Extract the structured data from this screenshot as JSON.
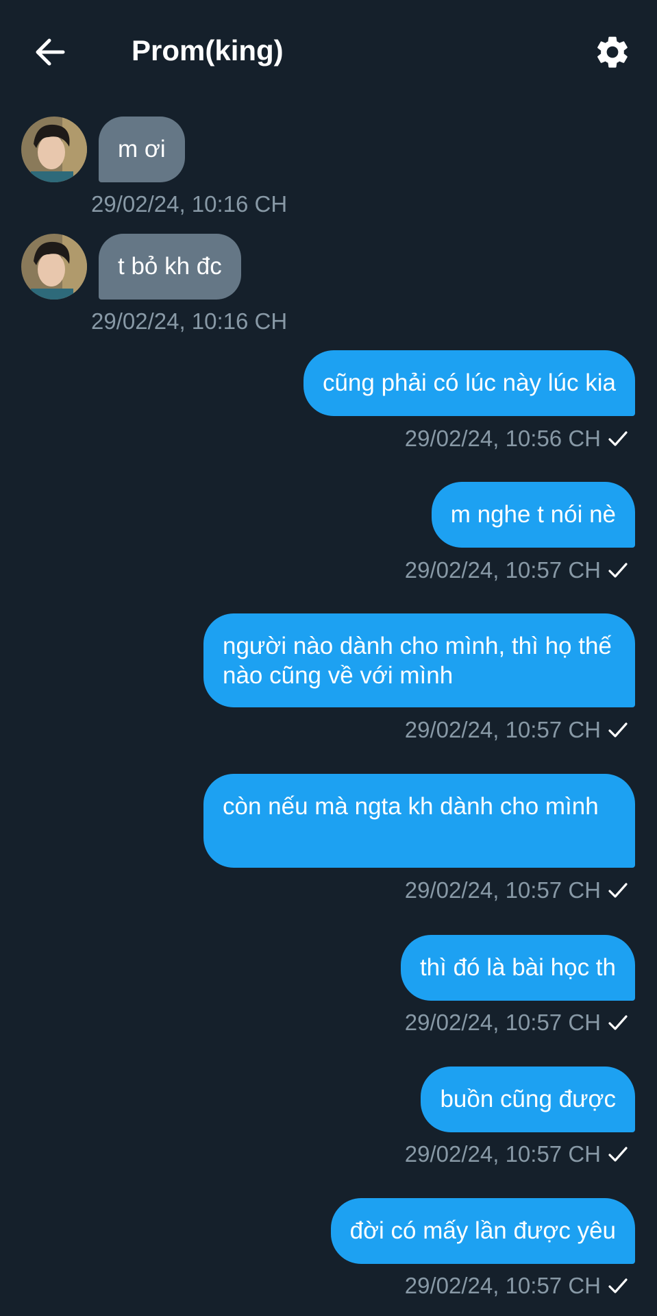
{
  "header": {
    "title": "Prom(king)"
  },
  "colors": {
    "background": "#15202b",
    "incoming_bubble": "#657786",
    "outgoing_bubble": "#1da1f2",
    "timestamp": "#8899a6"
  },
  "icons": {
    "back": "arrow-left-icon",
    "settings": "gear-icon",
    "read": "check-icon"
  },
  "messages": [
    {
      "direction": "in",
      "text": "m ơi",
      "time": "29/02/24, 10:16 CH"
    },
    {
      "direction": "in",
      "text": "t bỏ kh đc",
      "time": "29/02/24, 10:16 CH"
    },
    {
      "direction": "out",
      "text": "cũng phải có lúc này lúc kia",
      "time": "29/02/24, 10:56 CH"
    },
    {
      "direction": "out",
      "text": "m nghe t nói nè",
      "time": "29/02/24, 10:57 CH"
    },
    {
      "direction": "out",
      "text": "người nào dành cho mình, thì họ thế nào cũng về với mình",
      "time": "29/02/24, 10:57 CH"
    },
    {
      "direction": "out",
      "text": "còn nếu mà ngta kh dành cho mình",
      "time": "29/02/24, 10:57 CH"
    },
    {
      "direction": "out",
      "text": "thì đó là bài học th",
      "time": "29/02/24, 10:57 CH"
    },
    {
      "direction": "out",
      "text": "buồn cũng được",
      "time": "29/02/24, 10:57 CH"
    },
    {
      "direction": "out",
      "text": "đời có mấy lần được yêu",
      "time": "29/02/24, 10:57 CH"
    }
  ]
}
